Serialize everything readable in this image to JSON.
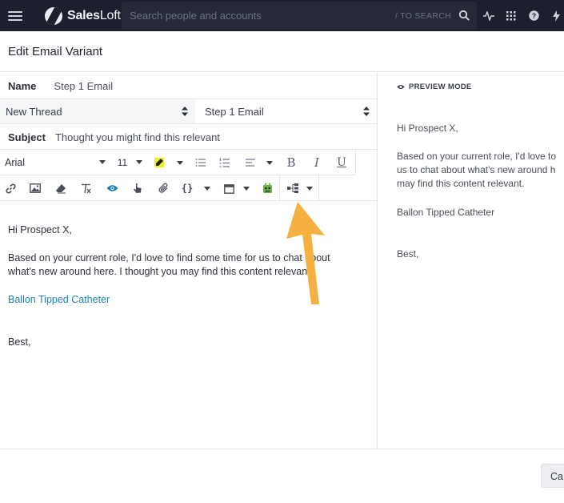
{
  "topnav": {
    "brand_bold": "Sales",
    "brand_light": "Loft",
    "search_placeholder": "Search people and accounts",
    "search_hint": "/ TO SEARCH"
  },
  "page": {
    "title": "Edit Email Variant"
  },
  "form": {
    "name_label": "Name",
    "name_value": "Step 1 Email",
    "thread_select": "New Thread",
    "step_select": "Step 1 Email",
    "subject_label": "Subject",
    "subject_value": "Thought you might find this relevant"
  },
  "toolbar": {
    "font_family": "Arial",
    "font_size": "11",
    "icons_row1": [
      "highlight-icon",
      "bullet-list-icon",
      "numbered-list-icon",
      "align-icon",
      "bold-icon",
      "italic-icon",
      "underline-icon"
    ],
    "bold": "B",
    "italic": "I",
    "underline": "U",
    "icons_row2": [
      "link-icon",
      "image-icon",
      "eraser-icon",
      "clear-format-icon",
      "eye-icon",
      "hand-pointer-icon",
      "paperclip-icon",
      "braces-icon",
      "calendar-icon",
      "robot-icon",
      "branch-icon"
    ],
    "braces": "{}",
    "accent": "#1c7fb8"
  },
  "editor": {
    "greeting": "Hi Prospect X,",
    "body_line1": "Based on your current role, I'd love to find some time for us to chat about",
    "body_line2": "what's new around here. I thought you may find this content relevant.",
    "link": "Ballon Tipped Catheter",
    "signoff": "Best,"
  },
  "preview": {
    "label": "PREVIEW MODE",
    "greeting": "Hi Prospect X,",
    "line1": "Based on your current role, I'd love to",
    "line2": "us to chat about what's new around h",
    "line3": "may find this content relevant.",
    "link": "Ballon Tipped Catheter",
    "signoff": "Best,"
  },
  "footer": {
    "cancel": "Ca"
  },
  "colors": {
    "nav_bg": "#1c1f2e",
    "link": "#1c7fb8",
    "arrow": "#f5b041"
  }
}
